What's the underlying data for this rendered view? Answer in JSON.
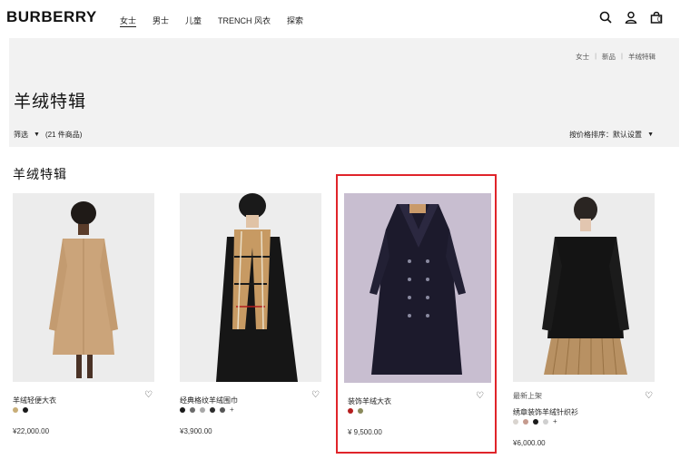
{
  "brand": "BURBERRY",
  "nav": [
    "女士",
    "男士",
    "儿童",
    "TRENCH 风衣",
    "探索"
  ],
  "cart_count": "0",
  "breadcrumb": [
    "女士",
    "新品",
    "羊绒特辑"
  ],
  "hero_title": "羊绒特辑",
  "filter_label": "筛选",
  "item_count": "(21 件商品)",
  "sort_label": "按价格排序：默认设置",
  "section_title": "羊绒特辑",
  "products": [
    {
      "tag": "",
      "name": "羊绒轻便大衣",
      "price": "¥22,000.00",
      "swatches": [
        "#c8ae78",
        "#1a1a1a"
      ],
      "has_plus": false
    },
    {
      "tag": "",
      "name": "经典格纹羊绒围巾",
      "price": "¥3,900.00",
      "swatches": [
        "#1a1a1a",
        "#6b6b6b",
        "#a8a8a8",
        "#2c2c2c",
        "#555555"
      ],
      "has_plus": true
    },
    {
      "tag": "",
      "name": "装饰羊绒大衣",
      "price": "¥ 9,500.00",
      "swatches": [
        "#b51e1e",
        "#8a8a5c"
      ],
      "has_plus": false
    },
    {
      "tag": "最新上架",
      "name": "绣章装饰羊绒针织衫",
      "price": "¥6,000.00",
      "swatches": [
        "#d9d4cf",
        "#c59a8e",
        "#1a1a1a",
        "#cfcfcf"
      ],
      "has_plus": true
    }
  ],
  "colors": {
    "highlight": "#e0242a",
    "hero_bg": "#f2f2f2"
  }
}
